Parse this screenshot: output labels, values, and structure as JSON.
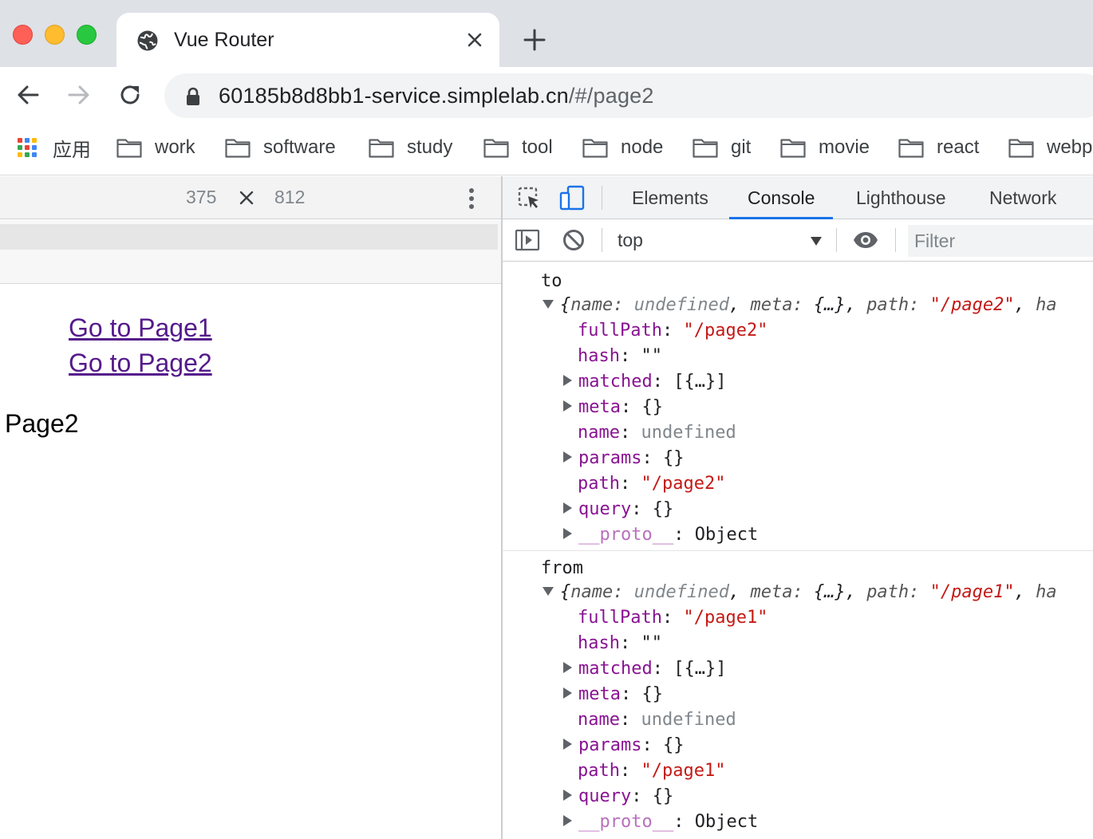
{
  "browser": {
    "tab": {
      "title": "Vue Router"
    },
    "address_bar": {
      "host": "60185b8d8bb1-service.simplelab.cn",
      "path": "/#/page2"
    },
    "bookmarks": [
      "应用",
      "work",
      "software",
      "study",
      "tool",
      "node",
      "git",
      "movie",
      "react",
      "webp"
    ]
  },
  "device_toolbar": {
    "width": "375",
    "separator": "×",
    "height": "812"
  },
  "page": {
    "links": [
      "Go to Page1",
      "Go to Page2"
    ],
    "content": "Page2"
  },
  "devtools": {
    "tabs": [
      "Elements",
      "Console",
      "Lighthouse",
      "Network"
    ],
    "active_tab": "Console",
    "context": "top",
    "filter_placeholder": "Filter",
    "logs": [
      {
        "label": "to",
        "summary": {
          "name_key": "name:",
          "name_val": "undefined",
          "meta_key": "meta:",
          "meta_val": "{…}",
          "path_key": "path:",
          "path_val": "\"/page2\"",
          "tail": "ha"
        },
        "props": {
          "fullPath": "\"/page2\"",
          "hash": "\"\"",
          "matched": "[{…}]",
          "meta": "{}",
          "name": "undefined",
          "params": "{}",
          "path": "\"/page2\"",
          "query": "{}",
          "proto": "Object"
        }
      },
      {
        "label": "from",
        "summary": {
          "name_key": "name:",
          "name_val": "undefined",
          "meta_key": "meta:",
          "meta_val": "{…}",
          "path_key": "path:",
          "path_val": "\"/page1\"",
          "tail": "ha"
        },
        "props": {
          "fullPath": "\"/page1\"",
          "hash": "\"\"",
          "matched": "[{…}]",
          "meta": "{}",
          "name": "undefined",
          "params": "{}",
          "path": "\"/page1\"",
          "query": "{}",
          "proto": "Object"
        }
      }
    ]
  },
  "colors": {
    "link_visited": "#551a8b",
    "console_key": "#881391",
    "console_string": "#c41a16",
    "devtools_accent": "#1a73e8"
  }
}
